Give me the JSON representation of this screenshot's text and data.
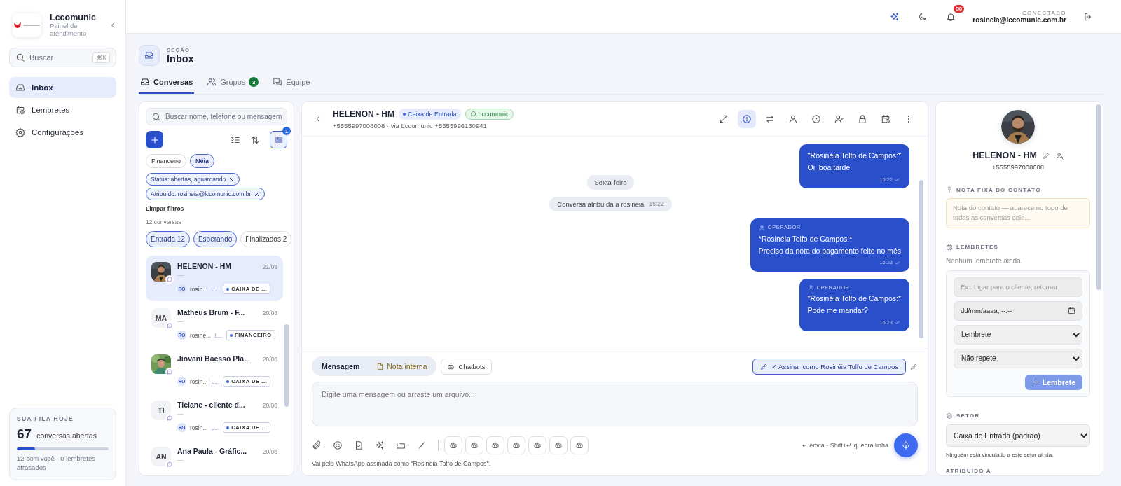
{
  "sidebar": {
    "brand": {
      "name": "Lccomunic",
      "subtitle": "Painel de atendimento"
    },
    "search": {
      "placeholder": "Buscar",
      "shortcut": "⌘K"
    },
    "nav": [
      {
        "label": "Inbox",
        "selected": true
      },
      {
        "label": "Lembretes",
        "selected": false
      },
      {
        "label": "Configurações",
        "selected": false
      }
    ],
    "queue": {
      "title": "SUA FILA HOJE",
      "count": "67",
      "label": "conversas abertas",
      "level": 0.2,
      "detail": "12 com você · 0 lembretes atrasados"
    }
  },
  "topbar": {
    "notifications": "50",
    "status_label": "CONECTADO",
    "user": "rosineia@lccomunic.com.br"
  },
  "section": {
    "eyebrow": "SEÇÃO",
    "title": "Inbox"
  },
  "tabs": [
    {
      "label": "Conversas",
      "selected": true
    },
    {
      "label": "Grupos",
      "badge": "3",
      "selected": false
    },
    {
      "label": "Equipe",
      "selected": false
    }
  ],
  "list": {
    "search_placeholder": "Buscar nome, telefone ou mensagem",
    "filter_count": "1",
    "sectors": [
      {
        "label": "Financeiro",
        "selected": false
      },
      {
        "label": "Néia",
        "selected": true
      }
    ],
    "active_filters": [
      "Status: abertas, aguardando",
      "Atribuído: rosineia@lccomunic.com.br"
    ],
    "clear": "Limpar filtros",
    "count": "12 conversas",
    "status_tabs": [
      {
        "label": "Entrada",
        "count": "12",
        "selected": true
      },
      {
        "label": "Esperando",
        "selected": true
      },
      {
        "label": "Finalizados",
        "count": "2",
        "selected": false
      }
    ],
    "conversations": [
      {
        "name": "HELENON - HM",
        "date": "21/08",
        "preview": "—",
        "agent_initials": "RO",
        "agent": "rosin...",
        "channel": "L...",
        "tag": "CAIXA DE ...",
        "selected": true
      },
      {
        "name": "Matheus Brum - F...",
        "date": "20/08",
        "kind": "initials",
        "initials": "MA",
        "preview": "—",
        "agent_initials": "RO",
        "agent": "rosine...",
        "channel": "L...",
        "tag": "FINANCEIRO",
        "selected": false
      },
      {
        "name": "Jiovani Baesso Pla...",
        "date": "20/08",
        "preview": "—",
        "agent_initials": "RO",
        "agent": "rosin...",
        "channel": "L...",
        "tag": "CAIXA DE ...",
        "selected": false
      },
      {
        "name": "Ticiane - cliente d...",
        "date": "20/08",
        "kind": "initials",
        "initials": "TI",
        "preview": "—",
        "agent_initials": "RO",
        "agent": "rosin...",
        "channel": "L...",
        "tag": "CAIXA DE ...",
        "selected": false
      },
      {
        "name": "Ana Paula - Gráfic...",
        "date": "20/08",
        "kind": "initials",
        "initials": "AN",
        "preview": "—",
        "selected": false
      }
    ]
  },
  "chat": {
    "name": "HELENON - HM",
    "sector_tag": "Caixa de Entrada",
    "channel_tag": "Lccomunic",
    "subtitle": "+5555997008008 · via Lccomunic +5555996130941",
    "actions": [
      {
        "selected": false
      },
      {
        "selected": true
      },
      {
        "selected": false
      },
      {
        "selected": false
      },
      {
        "selected": false
      },
      {
        "selected": false
      },
      {
        "selected": false
      },
      {
        "selected": false
      },
      {
        "selected": false
      }
    ],
    "messages": [
      {
        "kind": "bubble",
        "sender": "*Rosinéia Tolfo de Campos:*",
        "text": "Oi, boa tarde",
        "time": "16:22"
      },
      {
        "kind": "day",
        "text": "Sexta-feira"
      },
      {
        "kind": "event",
        "text": "Conversa atribuída a rosineia",
        "time": "16:22"
      },
      {
        "kind": "bubble",
        "role": "OPERADOR",
        "sender": "*Rosinéia Tolfo de Campos:*",
        "text": "Preciso da nota do pagamento feito no mês",
        "time": "16:23"
      },
      {
        "kind": "bubble",
        "role": "OPERADOR",
        "sender": "*Rosinéia Tolfo de Campos:*",
        "text": "Pode me mandar?",
        "time": "16:23"
      }
    ],
    "composer": {
      "modes": [
        {
          "label": "Mensagem",
          "kind": "message",
          "selected": true
        },
        {
          "label": "Nota interna",
          "kind": "note",
          "selected": false
        }
      ],
      "chatbots": "Chatbots",
      "sign": "✓ Assinar como Rosinéia Tolfo de Campos",
      "sign_on": true,
      "placeholder": "Digite uma mensagem ou arraste um arquivo...",
      "hint": "↵ envia · Shift+↵ quebra linha",
      "footer": "Vai pelo WhatsApp assinada como \"Rosinéia Tolfo de Campos\"."
    }
  },
  "contact": {
    "name": "HELENON - HM",
    "phone": "+5555997008008",
    "note": {
      "title": "NOTA FIXA DO CONTATO",
      "placeholder": "Nota do contato — aparece no topo de todas as conversas dele..."
    },
    "reminders": {
      "title": "LEMBRETES",
      "empty": "Nenhum lembrete ainda.",
      "input_placeholder": "Ex.: Ligar para o cliente, retornar",
      "date_value": "dd/mm/aaaa, --:--",
      "type": "Lembrete",
      "repeat": "Não repete",
      "add": "Lembrete"
    },
    "sector": {
      "title": "SETOR",
      "value": "Caixa de Entrada (padrão)",
      "note": "Ninguém está vinculado a este setor ainda."
    },
    "assigned_title": "ATRIBUÍDO A"
  }
}
